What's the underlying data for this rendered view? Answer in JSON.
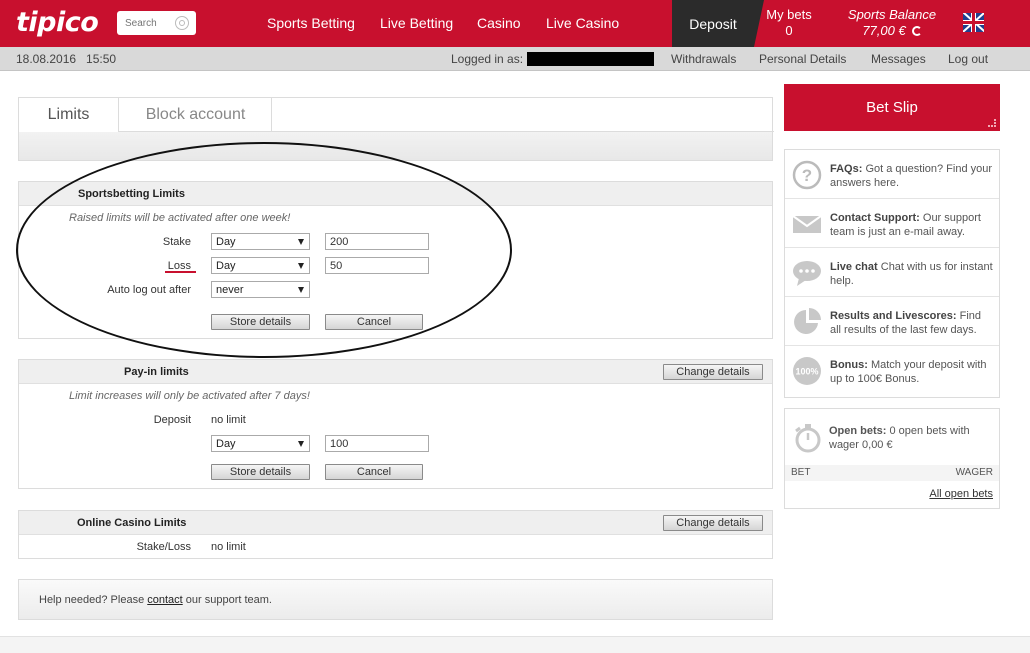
{
  "header": {
    "logo": "tipico",
    "search_placeholder": "Search",
    "nav": [
      "Sports Betting",
      "Live Betting",
      "Casino",
      "Live Casino"
    ],
    "deposit_label": "Deposit",
    "my_bets_label": "My bets",
    "my_bets_count": "0",
    "balance_label": "Sports Balance",
    "balance_value": "77,00 €",
    "brand_color": "#c8102e"
  },
  "subbar": {
    "datetime": "18.08.2016   15:50",
    "logged_in_label": "Logged in as:",
    "links": [
      "Withdrawals",
      "Personal Details",
      "Messages",
      "Log out"
    ]
  },
  "tabs": {
    "active": "Limits",
    "other": "Block account"
  },
  "sportsbetting": {
    "title": "Sportsbetting Limits",
    "note": "Raised limits will be activated after one week!",
    "stake_label": "Stake",
    "stake_period": "Day",
    "stake_value": "200",
    "loss_label": "Loss",
    "loss_period": "Day",
    "loss_value": "50",
    "autologout_label": "Auto log out after",
    "autologout_value": "never",
    "store_label": "Store details",
    "cancel_label": "Cancel"
  },
  "payin": {
    "title": "Pay-in limits",
    "change_label": "Change details",
    "note": "Limit increases will only be activated after 7 days!",
    "deposit_label": "Deposit",
    "deposit_value": "no limit",
    "period": "Day",
    "amount": "100",
    "store_label": "Store details",
    "cancel_label": "Cancel"
  },
  "casino": {
    "title": "Online Casino Limits",
    "change_label": "Change details",
    "stakeloss_label": "Stake/Loss",
    "stakeloss_value": "no limit"
  },
  "help": {
    "prefix": "Help needed? Please ",
    "link": "contact",
    "suffix": " our support team."
  },
  "sidebar": {
    "betslip_label": "Bet Slip",
    "items": [
      {
        "title": "FAQs:",
        "text": " Got a question? Find your answers here.",
        "icon": "question-icon"
      },
      {
        "title": "Contact Support:",
        "text": " Our support team is just an e-mail away.",
        "icon": "mail-icon"
      },
      {
        "title": "Live chat",
        "text": " Chat with us for instant help.",
        "icon": "chat-icon"
      },
      {
        "title": "Results and Livescores:",
        "text": " Find all results of the last few days.",
        "icon": "pie-chart-icon"
      },
      {
        "title": "Bonus:",
        "text": " Match your deposit with up to 100€ Bonus.",
        "icon": "bonus-100-icon"
      }
    ],
    "bonus_badge": "100%",
    "open_bets_title": "Open bets:",
    "open_bets_text": " 0 open bets with wager 0,00 €",
    "bet_col": "BET",
    "wager_col": "WAGER",
    "all_open_bets": "All open bets"
  }
}
